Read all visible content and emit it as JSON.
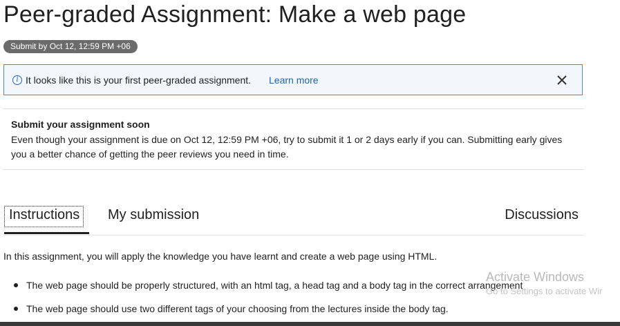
{
  "header": {
    "title": "Peer-graded Assignment: Make a web page",
    "due_badge": "Submit by Oct 12, 12:59 PM +06"
  },
  "info_banner": {
    "icon": "info-icon",
    "text": "It looks like this is your first peer-graded assignment.",
    "link_label": "Learn more",
    "close_icon": "close-icon"
  },
  "notice": {
    "title": "Submit your assignment soon",
    "body": "Even though your assignment is due on Oct 12, 12:59 PM +06, try to submit it 1 or 2 days early if you can. Submitting early gives you a better chance of getting the peer reviews you need in time."
  },
  "tabs": [
    {
      "label": "Instructions",
      "active": true
    },
    {
      "label": "My submission",
      "active": false
    },
    {
      "label": "Discussions",
      "active": false
    }
  ],
  "content": {
    "intro": "In this assignment, you will apply the knowledge you have learnt and create a web page using HTML.",
    "bullets": [
      "The web page should be properly structured, with an html tag, a head tag and a body tag in the correct arrangement",
      "The web page should use two different tags of your choosing from the lectures inside the body tag."
    ]
  },
  "watermark": {
    "line1": "Activate Windows",
    "line2": "Go to Settings to activate Wir"
  },
  "colors": {
    "link": "#1f62b5",
    "banner_border": "#4a8fb3",
    "badge_bg": "#6b6b6b"
  }
}
